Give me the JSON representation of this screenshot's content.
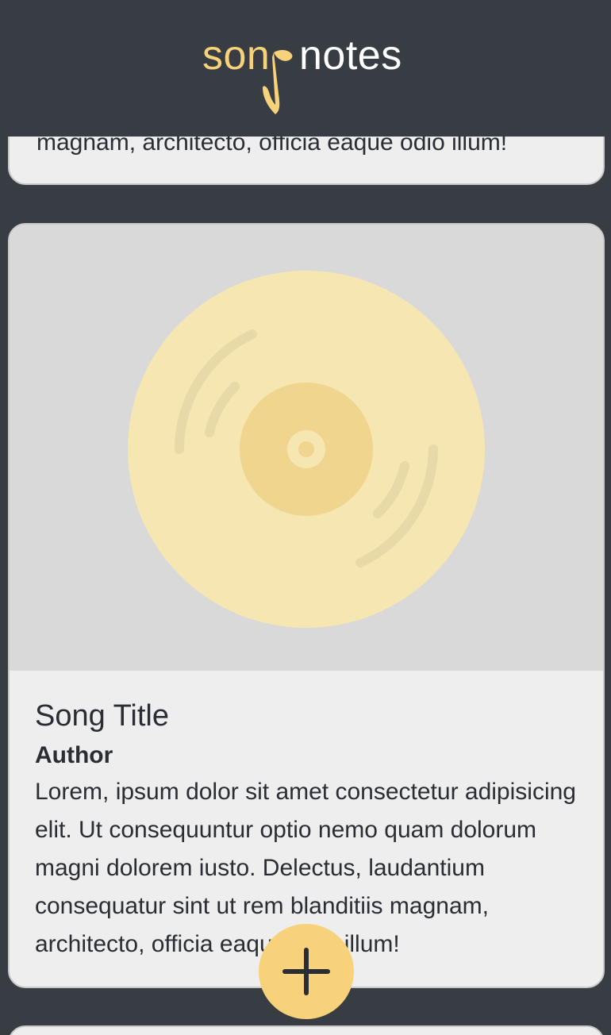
{
  "header": {
    "logo_part_a": "son",
    "logo_part_b": "notes",
    "logo_icon": "music-note-icon"
  },
  "previous_card": {
    "lyrics_tail": "magnam, architecto, officia eaque odio illum!"
  },
  "card": {
    "cover_icon": "vinyl-record-icon",
    "title": "Song Title",
    "author": "Author",
    "lyrics": "Lorem, ipsum dolor sit amet consectetur adipisicing elit. Ut consequuntur optio nemo quam dolorum magni dolorem iusto. Delectus, laudantium consequatur sint ut rem blanditiis magnam, architecto, officia eaque odio illum!"
  },
  "fab": {
    "icon": "plus-icon"
  },
  "colors": {
    "background": "#383d44",
    "accent": "#f7d27a",
    "card": "#eeeeee",
    "cover": "#d9d9d9",
    "text": "#2a2d33"
  }
}
